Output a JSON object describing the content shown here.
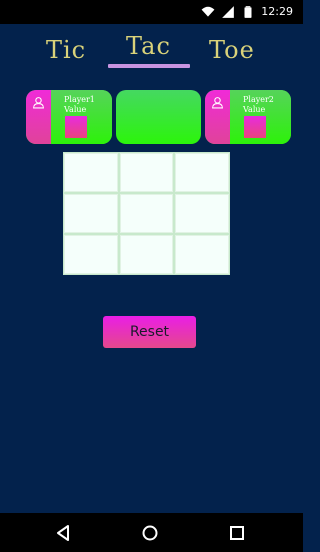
{
  "status_bar": {
    "time": "12:29",
    "icons": [
      "wifi-icon",
      "signal-icon",
      "battery-icon"
    ]
  },
  "title": {
    "word1": "Tic",
    "word2": "Tac",
    "word3": "Toe"
  },
  "players": [
    {
      "name": "Player1",
      "value_label": "Value",
      "icon": "user-icon"
    },
    {
      "name": "Player2",
      "value_label": "Value",
      "icon": "user-icon"
    }
  ],
  "board": {
    "rows": 3,
    "cols": 3,
    "cells": [
      "",
      "",
      "",
      "",
      "",
      "",
      "",
      "",
      ""
    ]
  },
  "reset_label": "Reset",
  "nav": {
    "icons": [
      "back-icon",
      "home-icon",
      "recent-apps-icon"
    ]
  },
  "colors": {
    "background": "#03224c",
    "title": "#d9d27a",
    "underline": "#c894e0",
    "card_green": "#3af018",
    "accent_pink": "#ea1ee6"
  }
}
